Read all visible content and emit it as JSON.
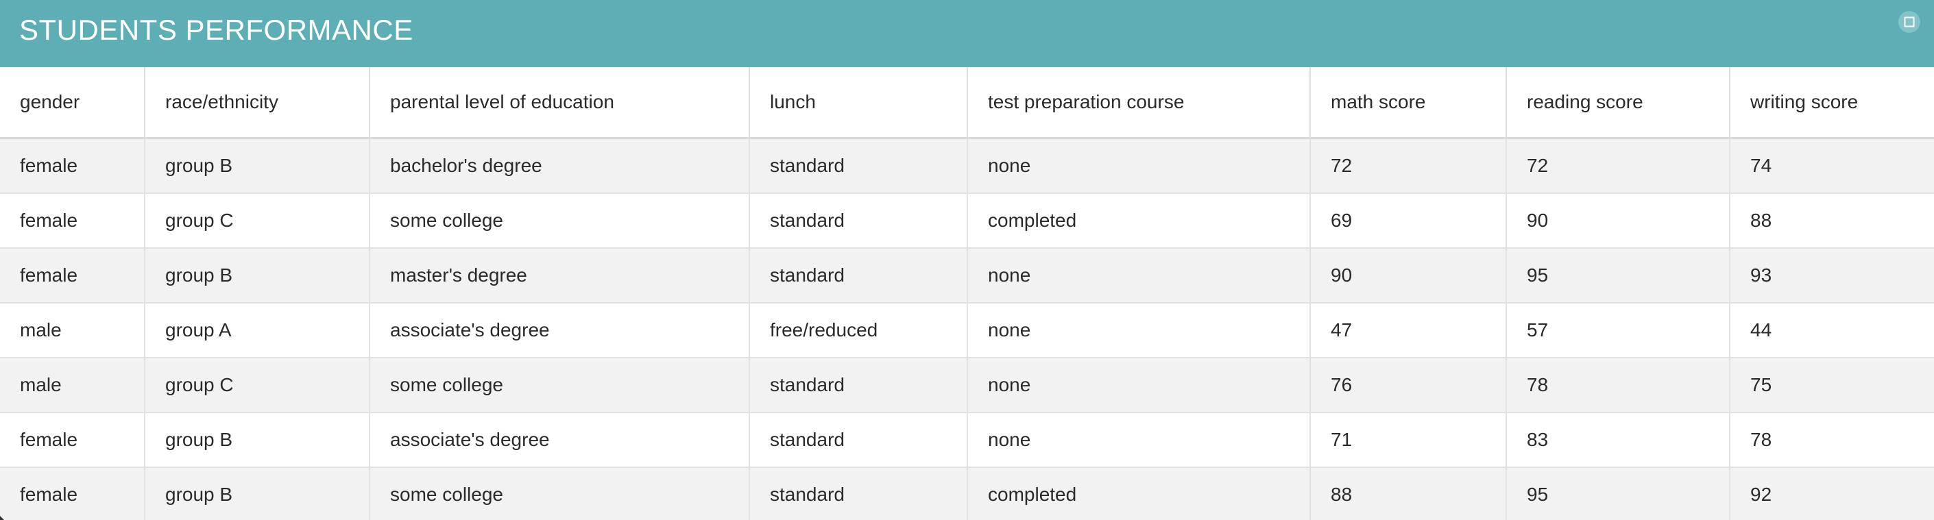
{
  "window": {
    "title": "STUDENTS PERFORMANCE",
    "accent_color": "#5eaeb6",
    "maximize_icon": "maximize-icon"
  },
  "table": {
    "columns": [
      "gender",
      "race/ethnicity",
      "parental level of education",
      "lunch",
      "test preparation course",
      "math score",
      "reading score",
      "writing score"
    ],
    "rows": [
      [
        "female",
        "group B",
        "bachelor's degree",
        "standard",
        "none",
        "72",
        "72",
        "74"
      ],
      [
        "female",
        "group C",
        "some college",
        "standard",
        "completed",
        "69",
        "90",
        "88"
      ],
      [
        "female",
        "group B",
        "master's degree",
        "standard",
        "none",
        "90",
        "95",
        "93"
      ],
      [
        "male",
        "group A",
        "associate's degree",
        "free/reduced",
        "none",
        "47",
        "57",
        "44"
      ],
      [
        "male",
        "group C",
        "some college",
        "standard",
        "none",
        "76",
        "78",
        "75"
      ],
      [
        "female",
        "group B",
        "associate's degree",
        "standard",
        "none",
        "71",
        "83",
        "78"
      ],
      [
        "female",
        "group B",
        "some college",
        "standard",
        "completed",
        "88",
        "95",
        "92"
      ]
    ]
  }
}
